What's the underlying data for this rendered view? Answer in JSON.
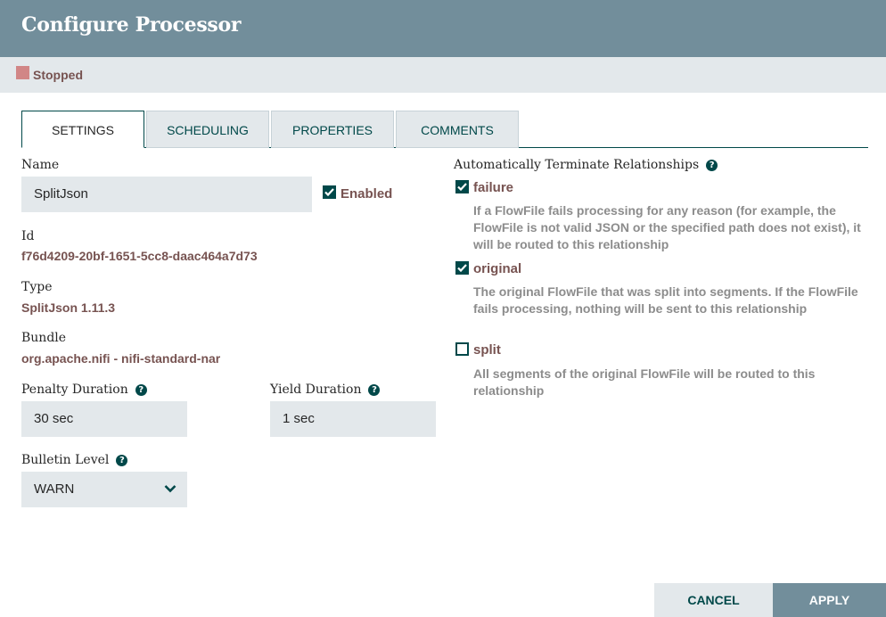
{
  "dialog": {
    "title": "Configure Processor"
  },
  "status": {
    "text": "Stopped",
    "color": "#d18686"
  },
  "tabs": [
    {
      "label": "SETTINGS",
      "active": true
    },
    {
      "label": "SCHEDULING",
      "active": false
    },
    {
      "label": "PROPERTIES",
      "active": false
    },
    {
      "label": "COMMENTS",
      "active": false
    }
  ],
  "settings": {
    "name_label": "Name",
    "name_value": "SplitJson",
    "enabled_label": "Enabled",
    "enabled": true,
    "id_label": "Id",
    "id_value": "f76d4209-20bf-1651-5cc8-daac464a7d73",
    "type_label": "Type",
    "type_value": "SplitJson 1.11.3",
    "bundle_label": "Bundle",
    "bundle_value": "org.apache.nifi - nifi-standard-nar",
    "penalty_label": "Penalty Duration",
    "penalty_value": "30 sec",
    "yield_label": "Yield Duration",
    "yield_value": "1 sec",
    "bulletin_label": "Bulletin Level",
    "bulletin_value": "WARN",
    "help_glyph": "?"
  },
  "relationships": {
    "heading": "Automatically Terminate Relationships",
    "items": [
      {
        "name": "failure",
        "checked": true,
        "description": "If a FlowFile fails processing for any reason (for example, the FlowFile is not valid JSON or the specified path does not exist), it will be routed to this relationship"
      },
      {
        "name": "original",
        "checked": true,
        "description": "The original FlowFile that was split into segments. If the FlowFile fails processing, nothing will be sent to this relationship"
      },
      {
        "name": "split",
        "checked": false,
        "description": "All segments of the original FlowFile will be routed to this relationship"
      }
    ]
  },
  "footer": {
    "cancel_label": "CANCEL",
    "apply_label": "APPLY"
  },
  "colors": {
    "header": "#728e9b",
    "accent": "#004849",
    "value_text": "#775351",
    "field_bg": "#e3e8eb"
  },
  "icons": {
    "status": "stopped-square-icon",
    "help": "help-circle-icon",
    "checkbox": "checkbox-icon",
    "select": "chevron-down-icon"
  }
}
